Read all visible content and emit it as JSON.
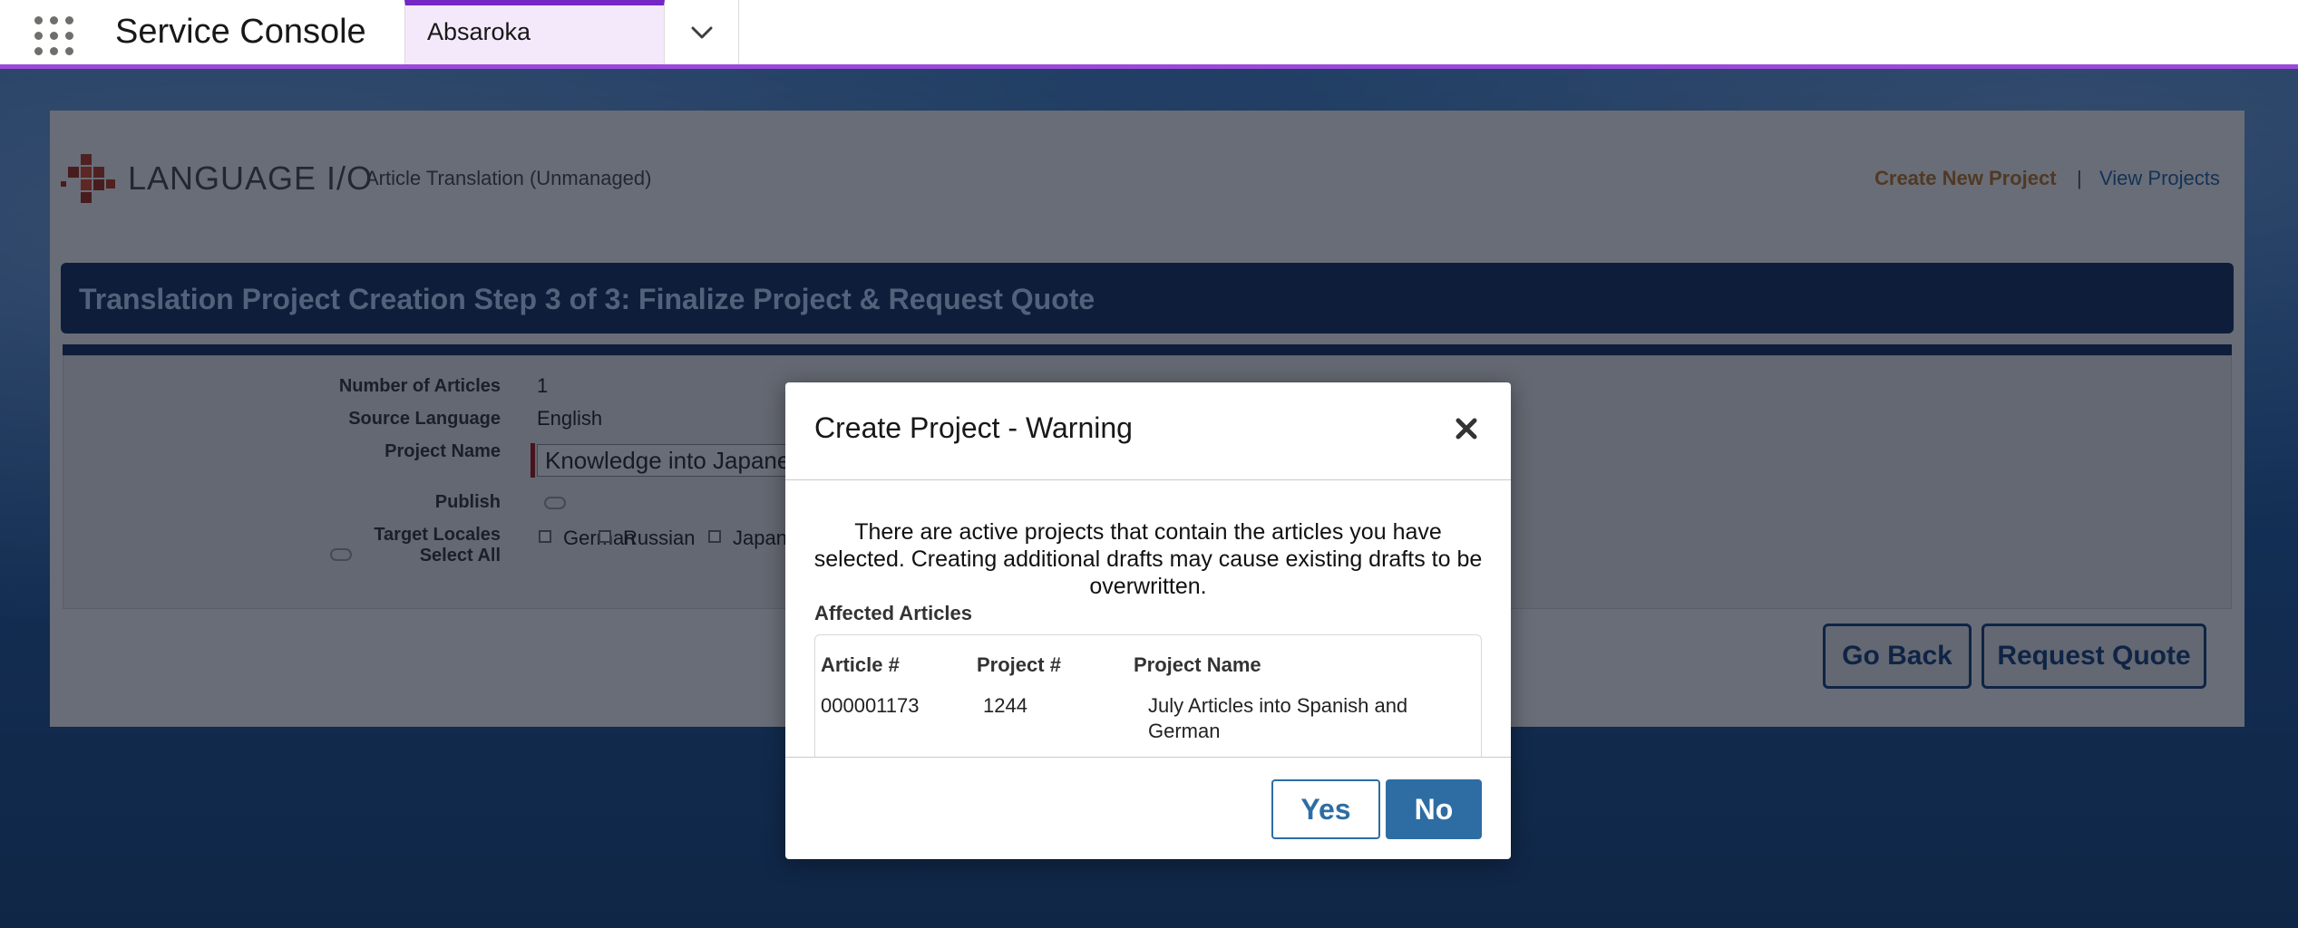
{
  "header": {
    "app_name": "Service Console",
    "tab_label": "Absaroka"
  },
  "app": {
    "logo_text": "LANGUAGE I/O",
    "logo_sub": "Article Translation (Unmanaged)",
    "nav": {
      "create_new_project": "Create New Project",
      "separator": "|",
      "view_projects": "View Projects"
    },
    "step_title": "Translation Project Creation Step 3 of 3: Finalize Project & Request Quote",
    "form": {
      "number_of_articles_label": "Number of Articles",
      "number_of_articles_value": "1",
      "source_language_label": "Source Language",
      "source_language_value": "English",
      "project_name_label": "Project Name",
      "project_name_value": "Knowledge into Japanese,",
      "publish_label": "Publish",
      "target_locales_label": "Target Locales",
      "select_all_label": "Select All",
      "locales": [
        "German",
        "Russian",
        "Japan"
      ]
    },
    "buttons": {
      "go_back": "Go Back",
      "request_quote": "Request Quote"
    }
  },
  "modal": {
    "title": "Create Project - Warning",
    "message": "There are active projects that contain the articles you have selected. Creating additional drafts may cause existing drafts to be overwritten.",
    "affected_title": "Affected Articles",
    "columns": [
      "Article #",
      "Project #",
      "Project Name"
    ],
    "rows": [
      {
        "article": "000001173",
        "project": "1244",
        "name": "July Articles into Spanish and German"
      }
    ],
    "yes_label": "Yes",
    "no_label": "No"
  },
  "colors": {
    "brand_purple": "#9b49d9",
    "dialog_primary": "#2e6da4",
    "banner_navy": "#13294a"
  }
}
